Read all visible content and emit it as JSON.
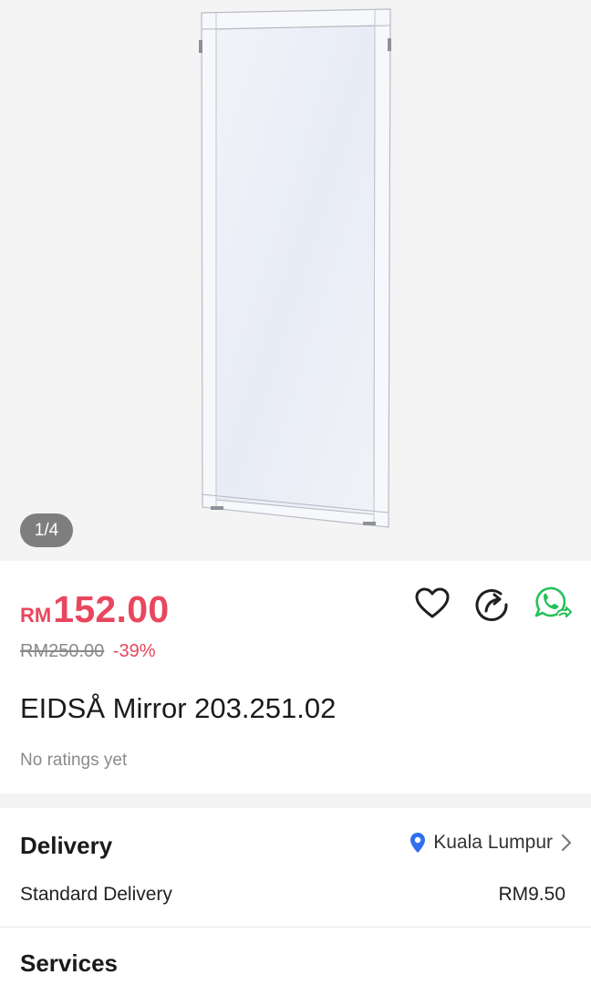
{
  "gallery": {
    "counter": "1/4"
  },
  "product": {
    "currency": "RM",
    "price": "152.00",
    "original_price": "RM250.00",
    "discount": "-39%",
    "title": "EIDSÅ Mirror 203.251.02",
    "ratings": "No ratings yet"
  },
  "actions": {
    "icons": [
      "heart-icon",
      "share-icon",
      "whatsapp-icon"
    ]
  },
  "delivery": {
    "title": "Delivery",
    "location": "Kuala Lumpur",
    "method": "Standard Delivery",
    "fee": "RM9.50"
  },
  "services": {
    "title": "Services"
  },
  "colors": {
    "price_red": "#e8475d",
    "whatsapp_green": "#25c15a",
    "pin_blue": "#2f6ff0"
  }
}
